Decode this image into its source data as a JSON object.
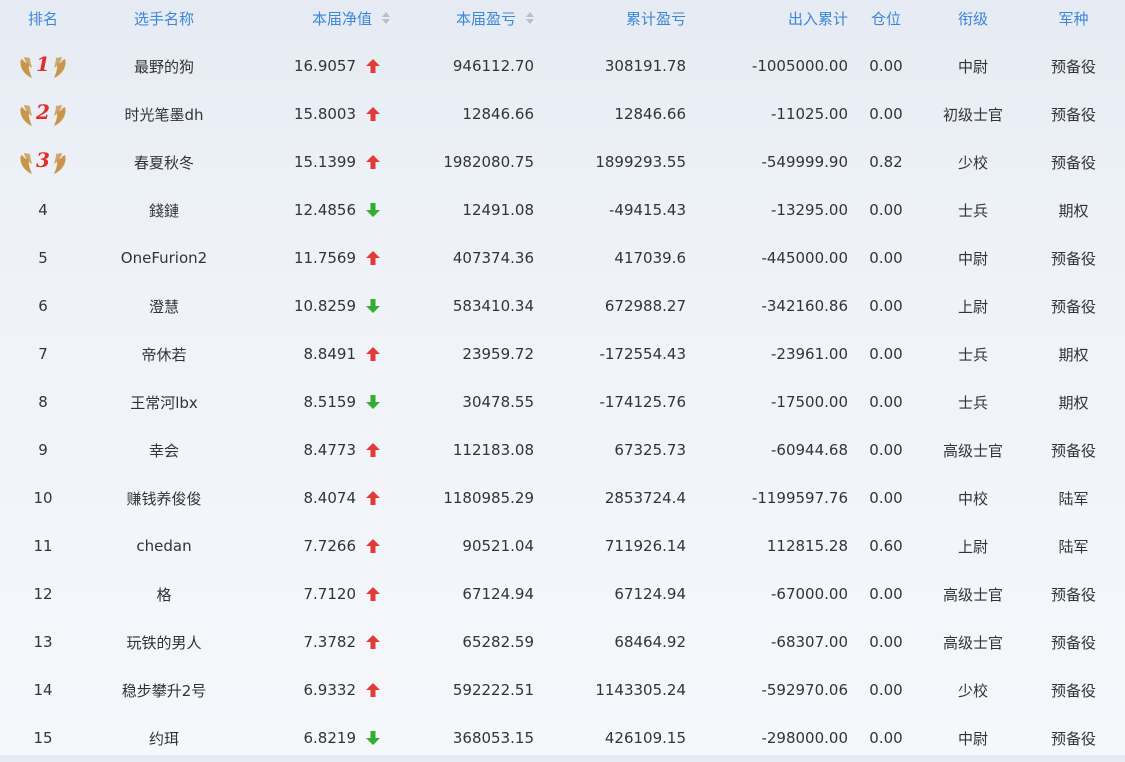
{
  "header": {
    "rank": "排名",
    "name": "选手名称",
    "nav": "本届净值",
    "pnl": "本届盈亏",
    "cum": "累计盈亏",
    "flow": "出入累计",
    "pos": "仓位",
    "grade": "衔级",
    "branch": "军种"
  },
  "colors": {
    "header_text": "#3d86d8",
    "up_arrow": "#e53935",
    "down_arrow": "#2fae2f",
    "medal_wing": "#c8954a",
    "medal_number": "#e32b2b"
  },
  "rows": [
    {
      "rank": "1",
      "medal": true,
      "name": "最野的狗",
      "nav": "16.9057",
      "trend": "up",
      "pnl": "946112.70",
      "cum": "308191.78",
      "flow": "-1005000.00",
      "pos": "0.00",
      "grade": "中尉",
      "branch": "预备役"
    },
    {
      "rank": "2",
      "medal": true,
      "name": "时光笔墨dh",
      "nav": "15.8003",
      "trend": "up",
      "pnl": "12846.66",
      "cum": "12846.66",
      "flow": "-11025.00",
      "pos": "0.00",
      "grade": "初级士官",
      "branch": "预备役"
    },
    {
      "rank": "3",
      "medal": true,
      "name": "春夏秋冬",
      "nav": "15.1399",
      "trend": "up",
      "pnl": "1982080.75",
      "cum": "1899293.55",
      "flow": "-549999.90",
      "pos": "0.82",
      "grade": "少校",
      "branch": "预备役"
    },
    {
      "rank": "4",
      "medal": false,
      "name": "錢鏈",
      "nav": "12.4856",
      "trend": "down",
      "pnl": "12491.08",
      "cum": "-49415.43",
      "flow": "-13295.00",
      "pos": "0.00",
      "grade": "士兵",
      "branch": "期权"
    },
    {
      "rank": "5",
      "medal": false,
      "name": "OneFurion2",
      "nav": "11.7569",
      "trend": "up",
      "pnl": "407374.36",
      "cum": "417039.6",
      "flow": "-445000.00",
      "pos": "0.00",
      "grade": "中尉",
      "branch": "预备役"
    },
    {
      "rank": "6",
      "medal": false,
      "name": "澄慧",
      "nav": "10.8259",
      "trend": "down",
      "pnl": "583410.34",
      "cum": "672988.27",
      "flow": "-342160.86",
      "pos": "0.00",
      "grade": "上尉",
      "branch": "预备役"
    },
    {
      "rank": "7",
      "medal": false,
      "name": "帝休若",
      "nav": "8.8491",
      "trend": "up",
      "pnl": "23959.72",
      "cum": "-172554.43",
      "flow": "-23961.00",
      "pos": "0.00",
      "grade": "士兵",
      "branch": "期权"
    },
    {
      "rank": "8",
      "medal": false,
      "name": "王常河lbx",
      "nav": "8.5159",
      "trend": "down",
      "pnl": "30478.55",
      "cum": "-174125.76",
      "flow": "-17500.00",
      "pos": "0.00",
      "grade": "士兵",
      "branch": "期权"
    },
    {
      "rank": "9",
      "medal": false,
      "name": "幸会",
      "nav": "8.4773",
      "trend": "up",
      "pnl": "112183.08",
      "cum": "67325.73",
      "flow": "-60944.68",
      "pos": "0.00",
      "grade": "高级士官",
      "branch": "预备役"
    },
    {
      "rank": "10",
      "medal": false,
      "name": "赚钱养俊俊",
      "nav": "8.4074",
      "trend": "up",
      "pnl": "1180985.29",
      "cum": "2853724.4",
      "flow": "-1199597.76",
      "pos": "0.00",
      "grade": "中校",
      "branch": "陆军"
    },
    {
      "rank": "11",
      "medal": false,
      "name": "chedan",
      "nav": "7.7266",
      "trend": "up",
      "pnl": "90521.04",
      "cum": "711926.14",
      "flow": "112815.28",
      "pos": "0.60",
      "grade": "上尉",
      "branch": "陆军"
    },
    {
      "rank": "12",
      "medal": false,
      "name": "格",
      "nav": "7.7120",
      "trend": "up",
      "pnl": "67124.94",
      "cum": "67124.94",
      "flow": "-67000.00",
      "pos": "0.00",
      "grade": "高级士官",
      "branch": "预备役"
    },
    {
      "rank": "13",
      "medal": false,
      "name": "玩铁的男人",
      "nav": "7.3782",
      "trend": "up",
      "pnl": "65282.59",
      "cum": "68464.92",
      "flow": "-68307.00",
      "pos": "0.00",
      "grade": "高级士官",
      "branch": "预备役"
    },
    {
      "rank": "14",
      "medal": false,
      "name": "稳步攀升2号",
      "nav": "6.9332",
      "trend": "up",
      "pnl": "592222.51",
      "cum": "1143305.24",
      "flow": "-592970.06",
      "pos": "0.00",
      "grade": "少校",
      "branch": "预备役"
    },
    {
      "rank": "15",
      "medal": false,
      "name": "约珥",
      "nav": "6.8219",
      "trend": "down",
      "pnl": "368053.15",
      "cum": "426109.15",
      "flow": "-298000.00",
      "pos": "0.00",
      "grade": "中尉",
      "branch": "预备役"
    }
  ]
}
